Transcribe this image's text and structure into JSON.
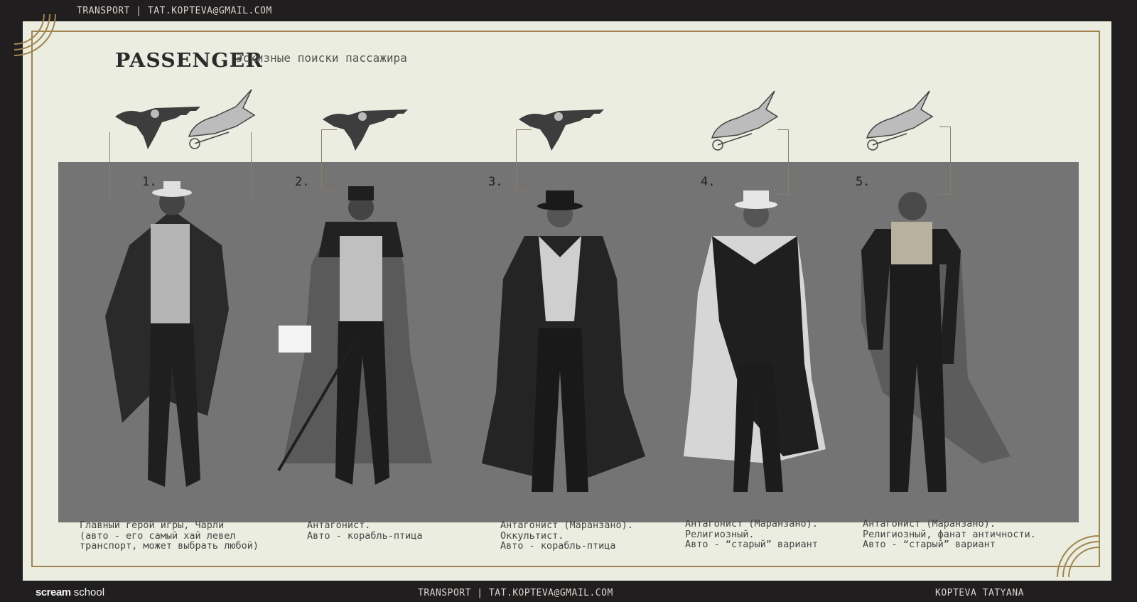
{
  "header": {
    "label": "TRANSPORT | TAT.KOPTEVA@GMAIL.COM"
  },
  "title": "PASSENGER",
  "subtitle": "Эскизные поиски пассажира",
  "sketches": [
    {
      "number": "1.",
      "caption": "Главный герой игры, Чарли\n(авто - его самый хай левел\nтранспорт, может выбрать любой)"
    },
    {
      "number": "2.",
      "caption": "Антагонист.\nАвто - корабль-птица"
    },
    {
      "number": "3.",
      "caption": "Антагонист (Маранзано).\nОккультист.\nАвто - корабль-птица"
    },
    {
      "number": "4.",
      "caption": "Антагонист (Маранзано).\nРелигиозный.\nАвто - “старый” вариант"
    },
    {
      "number": "5.",
      "caption": "Антагонист (Маранзано).\nРелигиозный, фанат античности.\nАвто - “старый” вариант"
    }
  ],
  "footer": {
    "brand_bold": "scream",
    "brand_light": " school",
    "center": "TRANSPORT | TAT.KOPTEVA@GMAIL.COM",
    "right": "KOPTEVA TATYANA"
  },
  "colors": {
    "accent": "#a1834f",
    "sheet": "#ebede0",
    "stage": "#747474",
    "background": "#201e1f"
  }
}
